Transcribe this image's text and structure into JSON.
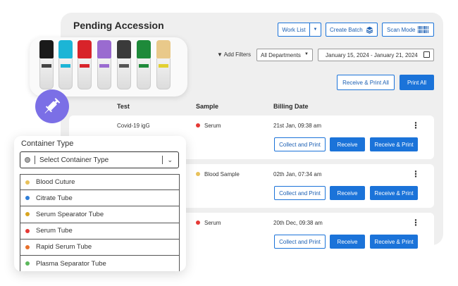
{
  "header": {
    "title": "Pending Accession",
    "work_list": "Work List",
    "create_batch": "Create Batch",
    "scan_mode": "Scan Mode"
  },
  "filters": {
    "add_filters": "Add Filters",
    "department": "All Departments",
    "date_range": "January 15, 2024 - January 21, 2024"
  },
  "actions": {
    "receive_print_all": "Receive & Print All",
    "print_all": "Print All"
  },
  "table": {
    "headers": {
      "test": "Test",
      "sample": "Sample",
      "billing_date": "Billing Date"
    },
    "rows": [
      {
        "test": "Covid-19 igG",
        "sample": "Serum",
        "sample_color": "#e53935",
        "billing_date": "21st Jan, 09:38 am",
        "collect": "Collect and Print",
        "receive": "Receive",
        "receive_print": "Receive & Print"
      },
      {
        "test": "",
        "sample": "Blood Sample",
        "sample_color": "#e8c15a",
        "billing_date": "02th Jan, 07:34 am",
        "collect": "Collect and Print",
        "receive": "Receive",
        "receive_print": "Receive & Print"
      },
      {
        "test": "",
        "sample": "Serum",
        "sample_color": "#e53935",
        "billing_date": "20th Dec, 09:38 am",
        "collect": "Collect and Print",
        "receive": "Receive",
        "receive_print": "Receive & Print"
      }
    ]
  },
  "container": {
    "label": "Container Type",
    "placeholder": "Select Container Type",
    "options": [
      {
        "label": "Blood Cuture",
        "color": "#e8c15a"
      },
      {
        "label": "Citrate Tube",
        "color": "#2f7ed8"
      },
      {
        "label": "Serum Spearator Tube",
        "color": "#d9a520"
      },
      {
        "label": "Serum Tube",
        "color": "#e53935"
      },
      {
        "label": "Rapid Serum Tube",
        "color": "#e8702a"
      },
      {
        "label": "Plasma Separator Tube",
        "color": "#5cb85c"
      }
    ]
  },
  "colors": {
    "accent": "#1b73d9",
    "syringe_badge": "#7b6fe6"
  }
}
